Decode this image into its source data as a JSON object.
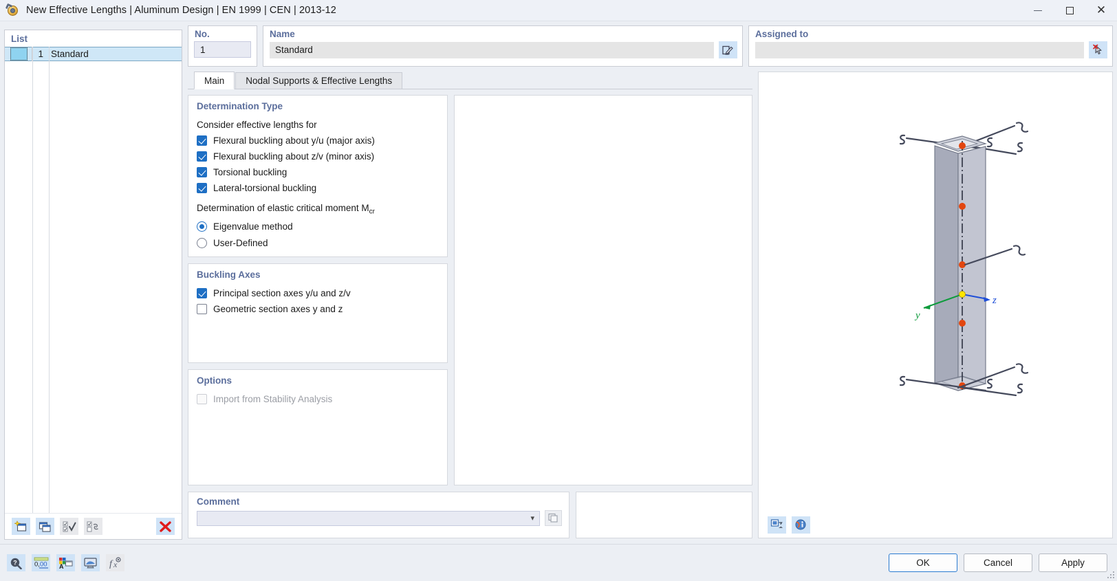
{
  "window": {
    "title": "New Effective Lengths | Aluminum Design | EN 1999 | CEN | 2013-12",
    "app_icon": "effective-lengths-icon",
    "minimize": "–",
    "maximize": "□",
    "close": "✕"
  },
  "list": {
    "title": "List",
    "rows": [
      {
        "no": "1",
        "name": "Standard",
        "color": "#8fd3f0"
      }
    ],
    "toolbar": [
      {
        "name": "new-item-button",
        "icon": "new-window-icon"
      },
      {
        "name": "copy-item-button",
        "icon": "copy-window-icon"
      },
      {
        "name": "select-all-button",
        "icon": "check-all-icon"
      },
      {
        "name": "invert-selection-button",
        "icon": "invert-check-icon"
      },
      {
        "name": "delete-item-button",
        "icon": "red-x-icon"
      }
    ]
  },
  "no_field": {
    "title": "No.",
    "value": "1"
  },
  "name_field": {
    "title": "Name",
    "value": "Standard",
    "edit_icon": "rename-icon"
  },
  "assigned_field": {
    "title": "Assigned to",
    "value": "",
    "pick_icon": "pick-cursor-icon"
  },
  "tabs": [
    {
      "label": "Main",
      "active": true
    },
    {
      "label": "Nodal Supports & Effective Lengths",
      "active": false
    }
  ],
  "determination_type": {
    "title": "Determination Type",
    "consider_label": "Consider effective lengths for",
    "checks": [
      {
        "label": "Flexural buckling about y/u (major axis)",
        "checked": true
      },
      {
        "label": "Flexural buckling about z/v (minor axis)",
        "checked": true
      },
      {
        "label": "Torsional buckling",
        "checked": true
      },
      {
        "label": "Lateral-torsional buckling",
        "checked": true
      }
    ],
    "moment_label_main": "Determination of elastic critical moment M",
    "moment_label_sub": "cr",
    "radios": [
      {
        "label": "Eigenvalue method",
        "selected": true
      },
      {
        "label": "User-Defined",
        "selected": false
      }
    ]
  },
  "buckling_axes": {
    "title": "Buckling Axes",
    "checks": [
      {
        "label": "Principal section axes y/u and z/v",
        "checked": true
      },
      {
        "label": "Geometric section axes y and z",
        "checked": false
      }
    ]
  },
  "options": {
    "title": "Options",
    "checks": [
      {
        "label": "Import from Stability Analysis",
        "checked": false,
        "disabled": true
      }
    ]
  },
  "comment": {
    "title": "Comment",
    "value": "",
    "placeholder": "",
    "dropdown_icon": "chevron-down-icon",
    "copy_icon": "copy-comment-icon"
  },
  "viewport": {
    "axis_y_label": "y",
    "axis_z_label": "z",
    "axis_y_color": "#0e9b3c",
    "axis_z_color": "#1f4fd8",
    "node_color": "#e2460f",
    "origin_color": "#ffe600",
    "member_fill": "#b6b9c6",
    "toolbar": [
      {
        "name": "render-mode-button",
        "icon": "render-view-icon"
      },
      {
        "name": "view-info-button",
        "icon": "info-globe-icon"
      }
    ]
  },
  "bottom_toolbar": [
    {
      "name": "help-button",
      "icon": "help-magnifier-icon"
    },
    {
      "name": "units-button",
      "icon": "decimal-places-icon"
    },
    {
      "name": "display-properties-button",
      "icon": "colors-icon"
    },
    {
      "name": "visual-settings-button",
      "icon": "screen-icon"
    },
    {
      "name": "formula-button",
      "icon": "fx-icon"
    }
  ],
  "dialog_buttons": {
    "ok": "OK",
    "cancel": "Cancel",
    "apply": "Apply"
  }
}
